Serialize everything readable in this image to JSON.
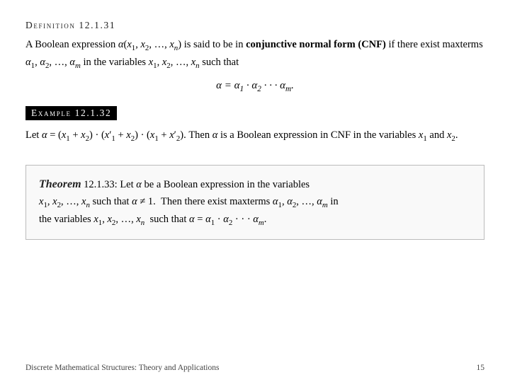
{
  "definition": {
    "title": "Definition 12.1.31",
    "body_text": "A Boolean expression α(x₁, x₂, …, xₙ) is said to be in conjunctive normal form (CNF) if there exist maxterms α₁, α₂, …, αₘ in the variables x₁, x₂, …, xₙ such that",
    "bold_phrase": "conjunctive normal form",
    "cnf_abbrev": "(CNF)",
    "formula": "α = α₁ · α₂ ··· αₘ."
  },
  "example": {
    "title": "Example 12.1.32",
    "body_text": "Let α = (x₁ + x₂) · (x₁′ + x₂) · (x₁ + x₂′). Then α is a Boolean expression in CNF in the variables x₁ and x₂."
  },
  "theorem": {
    "label": "Theorem",
    "number": "12.1.33:",
    "body_text": "Let α be a Boolean expression in the variables x₁, x₂, …, xₙ such that α ≠ 1. Then there exist maxterms α₁, α₂, …, αₘ in the variables x₁, x₂, …, xₙ such that α = α₁ · α₂ ··· αₘ."
  },
  "footer": {
    "left": "Discrete Mathematical Structures: Theory and Applications",
    "right": "15"
  }
}
